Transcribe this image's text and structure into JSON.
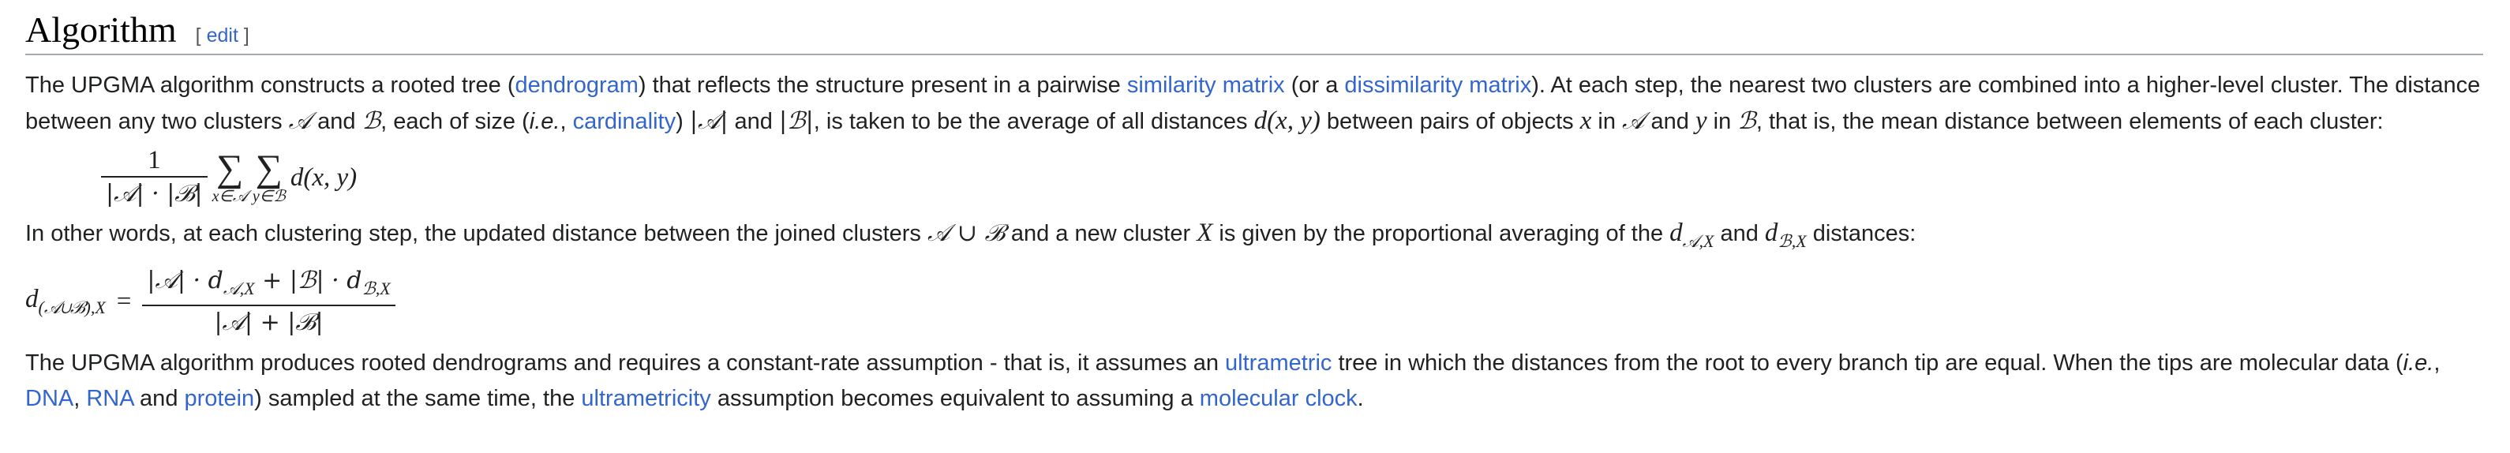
{
  "section": {
    "title": "Algorithm",
    "edit_open": "[",
    "edit_label": "edit",
    "edit_close": "]"
  },
  "para1": {
    "t1": "The UPGMA algorithm constructs a rooted tree (",
    "l1": "dendrogram",
    "t2": ") that reflects the structure present in a pairwise ",
    "l2": "similarity matrix",
    "t3": " (or a ",
    "l3": "dissimilarity matrix",
    "t4": "). At each step, the nearest two clusters are combined into a higher-level cluster. The distance between any two clusters ",
    "m1": "𝒜",
    "t5": " and ",
    "m2": "ℬ",
    "t6": ", each of size (",
    "ie": "i.e.",
    "t7": ", ",
    "l4": "cardinality",
    "t8": ") ",
    "m3": "|𝒜|",
    "t9": " and ",
    "m4": "|ℬ|",
    "t10": ", is taken to be the average of all distances ",
    "m5": "d(x, y)",
    "t11": " between pairs of objects ",
    "m6": "x",
    "t12": " in ",
    "m7": "𝒜",
    "t13": " and ",
    "m8": "y",
    "t14": " in ",
    "m9": "ℬ",
    "t15": ", that is, the mean distance between elements of each cluster:"
  },
  "formula1": {
    "numerator": "1",
    "denominator": "|𝒜| · |ℬ|",
    "sigma": "∑",
    "sub1": "x∈𝒜",
    "sub2": "y∈ℬ",
    "term": "d(x, y)"
  },
  "para2": {
    "t1": "In other words, at each clustering step, the updated distance between the joined clusters ",
    "m1": "𝒜 ∪ ℬ",
    "t2": " and a new cluster ",
    "m2": "X",
    "t3": " is given by the proportional averaging of the ",
    "m3": "d",
    "m3sub": "𝒜,X",
    "t4": " and ",
    "m4": "d",
    "m4sub": "ℬ,X",
    "t5": " distances:"
  },
  "formula2": {
    "lhs": "d",
    "lhs_sub": "(𝒜∪ℬ),X",
    "eq": "=",
    "num_a": "|𝒜| · d",
    "num_a_sub": "𝒜,X",
    "num_plus": " + |ℬ| · d",
    "num_b_sub": "ℬ,X",
    "den": "|𝒜| + |ℬ|"
  },
  "para3": {
    "t1": "The UPGMA algorithm produces rooted dendrograms and requires a constant-rate assumption - that is, it assumes an ",
    "l1": "ultrametric",
    "t2": " tree in which the distances from the root to every branch tip are equal. When the tips are molecular data (",
    "ie": "i.e.",
    "t3": ", ",
    "l2": "DNA",
    "t4": ", ",
    "l3": "RNA",
    "t5": " and ",
    "l4": "protein",
    "t6": ") sampled at the same time, the ",
    "l5": "ultrametricity",
    "t7": " assumption becomes equivalent to assuming a ",
    "l6": "molecular clock",
    "t8": "."
  }
}
